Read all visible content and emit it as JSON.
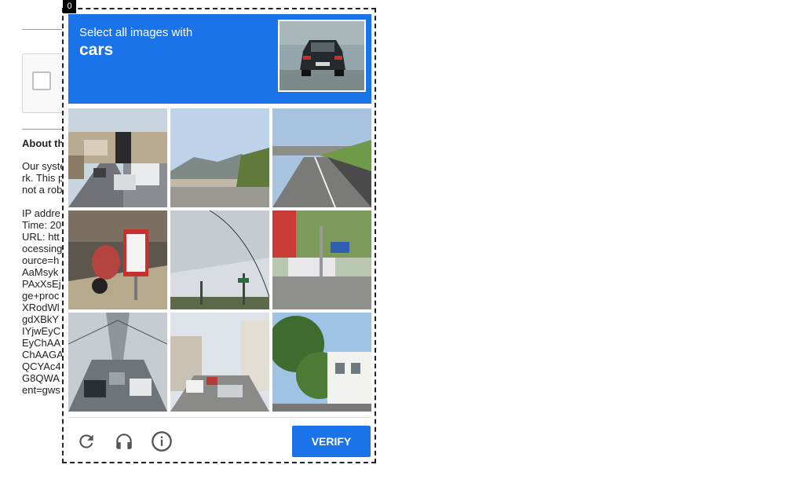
{
  "background": {
    "heading": "About th",
    "lines": [
      "Our syste",
      "rk. This p",
      "not a rob",
      "IP addre",
      "Time: 20",
      "URL: htt",
      "ocessing",
      "ource=h",
      "AaMsyk",
      "PAxXsEj",
      "ge+proc",
      "XRodWl",
      "gdXBkY",
      "IYjwEyC",
      "EyChAA",
      "ChAAGA",
      "QCYAc4",
      "G8QWA",
      "ent=gws"
    ]
  },
  "challenge": {
    "frame_index": "0",
    "instruction": "Select all images with",
    "target": "cars",
    "tiles": [
      {
        "id": 1,
        "scene": "street with parked truck and cars"
      },
      {
        "id": 2,
        "scene": "overpass with hills and sky"
      },
      {
        "id": 3,
        "scene": "highway with bridge"
      },
      {
        "id": 4,
        "scene": "motorcycle near parking sign"
      },
      {
        "id": 5,
        "scene": "cloudy sky with traffic lights"
      },
      {
        "id": 6,
        "scene": "street with bus and trees"
      },
      {
        "id": 7,
        "scene": "bridge with traffic"
      },
      {
        "id": 8,
        "scene": "city street with cars"
      },
      {
        "id": 9,
        "scene": "trees and house"
      }
    ],
    "verify_label": "VERIFY",
    "icons": [
      "reload-icon",
      "audio-icon",
      "info-icon"
    ]
  },
  "colors": {
    "accent": "#1a73e8"
  }
}
